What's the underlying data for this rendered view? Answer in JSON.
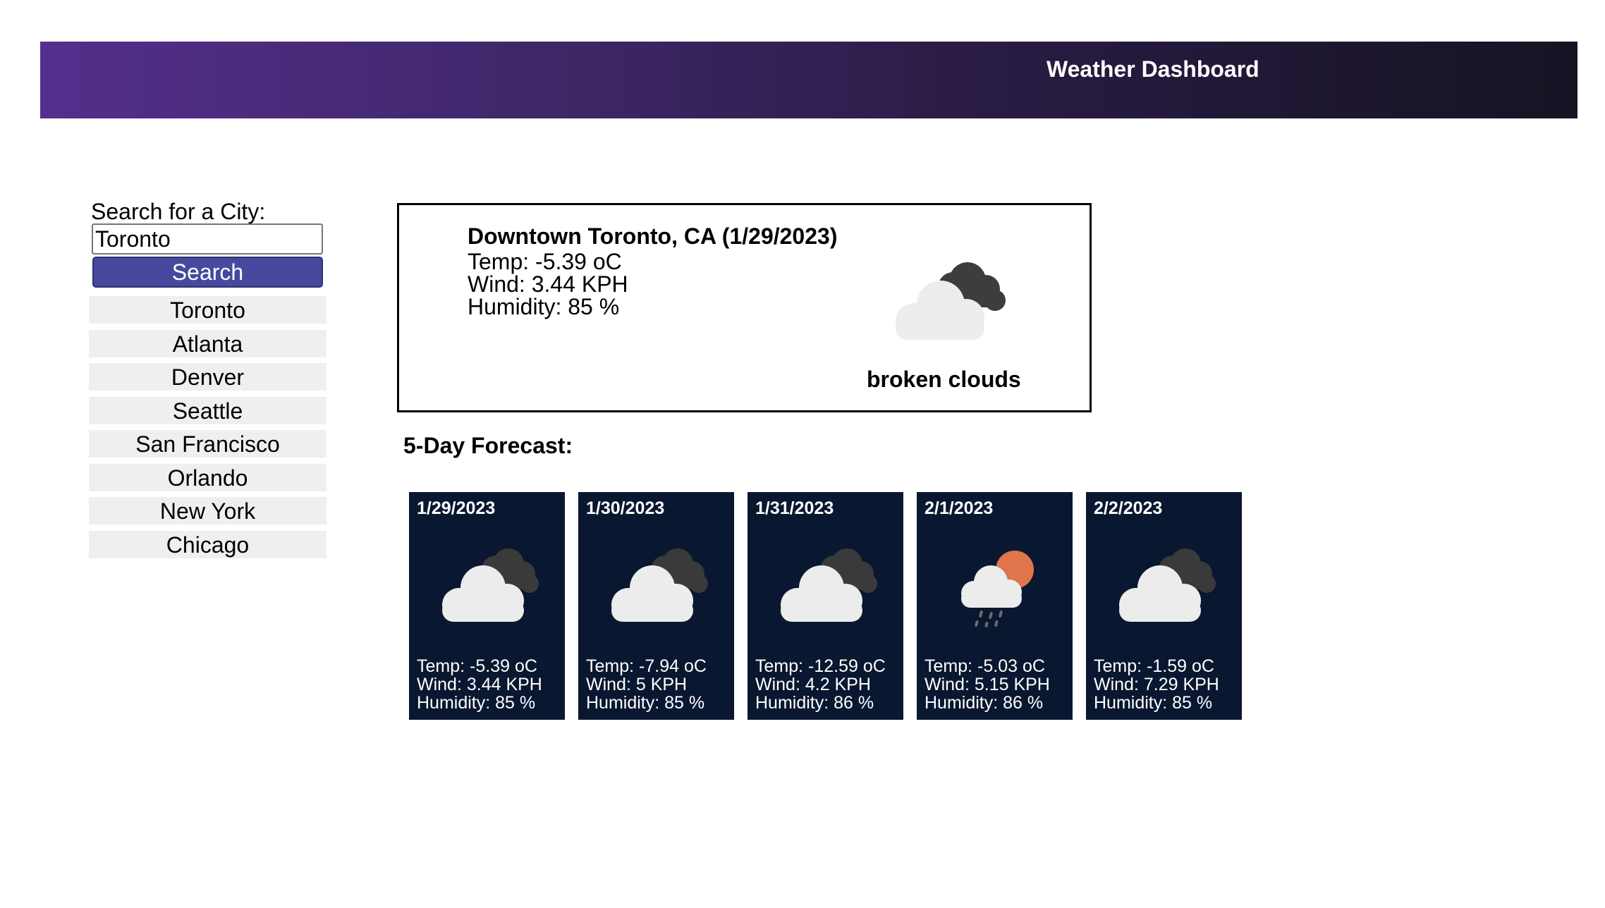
{
  "header": {
    "title": "Weather Dashboard"
  },
  "search": {
    "label": "Search for a City:",
    "value": "Toronto",
    "button_label": "Search"
  },
  "history": [
    "Toronto",
    "Atlanta",
    "Denver",
    "Seattle",
    "San Francisco",
    "Orlando",
    "New York",
    "Chicago"
  ],
  "current": {
    "city_heading": "Downtown Toronto, CA (1/29/2023)",
    "temp": "Temp: -5.39 oC",
    "wind": "Wind: 3.44 KPH",
    "humidity": "Humidity: 85 %",
    "icon": "broken-clouds-icon",
    "description": "broken clouds"
  },
  "forecast": {
    "title": "5-Day Forecast:",
    "days": [
      {
        "date": "1/29/2023",
        "icon": "broken-clouds-icon",
        "temp": "Temp: -5.39 oC",
        "wind": "Wind: 3.44 KPH",
        "humidity": "Humidity: 85 %"
      },
      {
        "date": "1/30/2023",
        "icon": "broken-clouds-icon",
        "temp": "Temp: -7.94 oC",
        "wind": "Wind: 5 KPH",
        "humidity": "Humidity: 85 %"
      },
      {
        "date": "1/31/2023",
        "icon": "broken-clouds-icon",
        "temp": "Temp: -12.59 oC",
        "wind": "Wind: 4.2 KPH",
        "humidity": "Humidity: 86 %"
      },
      {
        "date": "2/1/2023",
        "icon": "rain-sun-cloud-icon",
        "temp": "Temp: -5.03 oC",
        "wind": "Wind: 5.15 KPH",
        "humidity": "Humidity: 86 %"
      },
      {
        "date": "2/2/2023",
        "icon": "broken-clouds-icon",
        "temp": "Temp: -1.59 oC",
        "wind": "Wind: 7.29 KPH",
        "humidity": "Humidity: 85 %"
      }
    ]
  },
  "colors": {
    "header_gradient_start": "#552f8c",
    "header_gradient_end": "#161323",
    "search_button": "#46499e",
    "history_item_bg": "#efefef",
    "forecast_card_bg": "#0a1730"
  }
}
